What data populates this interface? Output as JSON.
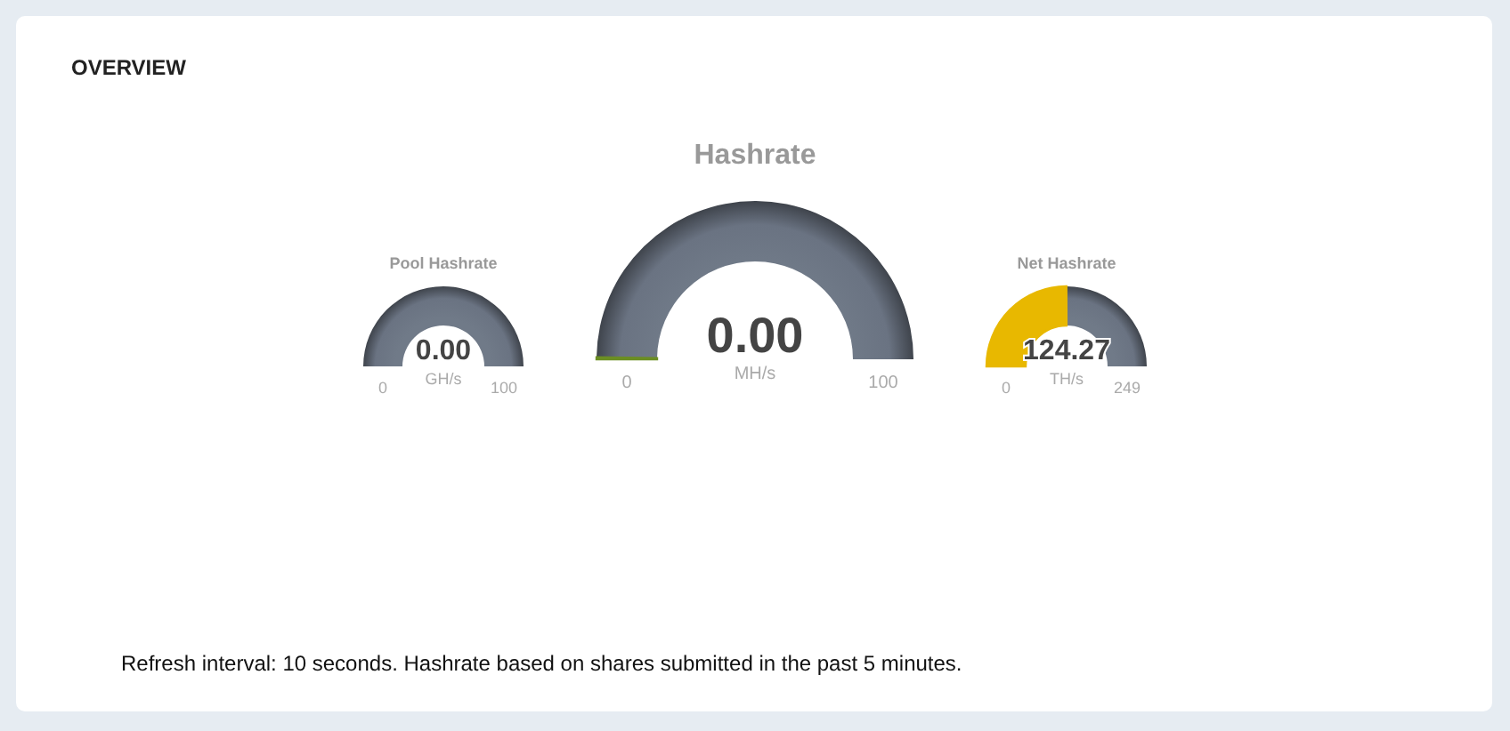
{
  "section_title": "OVERVIEW",
  "gauges": [
    {
      "kind": "small",
      "title": "Pool Hashrate",
      "value": "0.00",
      "unit": "GH/s",
      "min": "0",
      "max": "100"
    },
    {
      "kind": "large",
      "title": "Hashrate",
      "value": "0.00",
      "unit": "MH/s",
      "min": "0",
      "max": "100",
      "level": 0.004,
      "color": "#6b8e23"
    },
    {
      "kind": "small",
      "title": "Net Hashrate",
      "value": "124.27",
      "unit": "TH/s",
      "min": "0",
      "max": "249",
      "level": 0.499,
      "color": "#e8b800"
    }
  ],
  "footer_note": "Refresh interval: 10 seconds. Hashrate based on shares submitted in the past 5 minutes."
}
